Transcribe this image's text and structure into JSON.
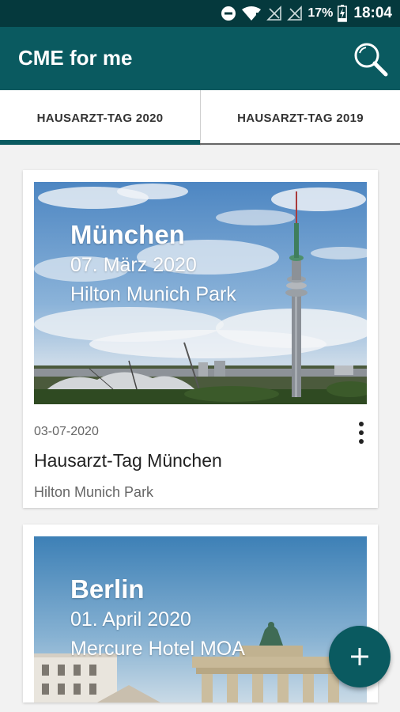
{
  "status_bar": {
    "battery": "17%",
    "time": "18:04",
    "icons": [
      "do-not-disturb-icon",
      "wifi-icon",
      "no-signal-icon",
      "no-signal-icon",
      "battery-charging-icon"
    ]
  },
  "app_bar": {
    "title": "CME for me",
    "search_icon": "search-icon"
  },
  "tabs": [
    {
      "label": "HAUSARZT-TAG 2020",
      "selected": true
    },
    {
      "label": "HAUSARZT-TAG 2019",
      "selected": false
    }
  ],
  "events": [
    {
      "image_city": "München",
      "image_date": "07. März 2020",
      "image_venue": "Hilton Munich Park",
      "date": "03-07-2020",
      "title": "Hausarzt-Tag München",
      "venue": "Hilton Munich Park"
    },
    {
      "image_city": "Berlin",
      "image_date": "01. April 2020",
      "image_venue": "Mercure Hotel MOA"
    }
  ],
  "fab": {
    "icon": "plus-icon"
  },
  "colors": {
    "status_bar": "#05393d",
    "app_bar": "#0a5a60",
    "accent": "#0a5a60",
    "background": "#f2f2f2"
  }
}
